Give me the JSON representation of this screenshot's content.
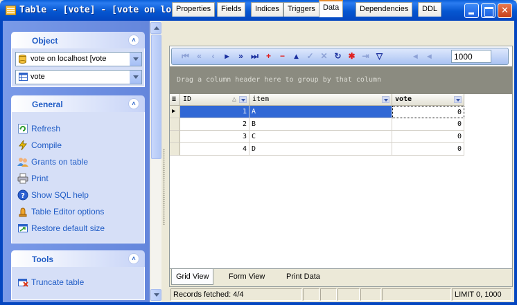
{
  "window": {
    "title": "Table - [vote] - [vote on localhost]"
  },
  "left_panel": {
    "object_group": {
      "title": "Object",
      "database_combo": "vote on localhost [vote",
      "table_combo": "vote"
    },
    "general_group": {
      "title": "General",
      "items": [
        {
          "label": "Refresh",
          "icon": "refresh-icon"
        },
        {
          "label": "Compile",
          "icon": "compile-icon"
        },
        {
          "label": "Grants on table",
          "icon": "grants-icon"
        },
        {
          "label": "Print",
          "icon": "print-icon"
        },
        {
          "label": "Show SQL help",
          "icon": "help-icon"
        },
        {
          "label": "Table Editor options",
          "icon": "options-icon"
        },
        {
          "label": "Restore default size",
          "icon": "restore-size-icon"
        }
      ]
    },
    "tools_group": {
      "title": "Tools",
      "items": [
        {
          "label": "Truncate table",
          "icon": "truncate-icon"
        }
      ]
    }
  },
  "tabs": [
    {
      "label": "Properties",
      "active": false
    },
    {
      "label": "Fields",
      "active": false
    },
    {
      "label": "Indices",
      "active": false
    },
    {
      "label": "Triggers",
      "active": false
    },
    {
      "label": "Data",
      "active": true
    },
    {
      "label": "Dependencies",
      "active": false
    },
    {
      "label": "DDL",
      "active": false
    }
  ],
  "navigator": {
    "record_limit": "1000"
  },
  "grid": {
    "group_hint": "Drag a column header here to group by that column",
    "columns": [
      "ID",
      "item",
      "vote"
    ],
    "rows": [
      {
        "id": "1",
        "item": "A",
        "vote": "0"
      },
      {
        "id": "2",
        "item": "B",
        "vote": "0"
      },
      {
        "id": "3",
        "item": "C",
        "vote": "0"
      },
      {
        "id": "4",
        "item": "D",
        "vote": "0"
      }
    ]
  },
  "view_tabs": [
    {
      "label": "Grid View",
      "active": true
    },
    {
      "label": "Form View",
      "active": false
    },
    {
      "label": "Print Data",
      "active": false
    }
  ],
  "status": {
    "records": "Records fetched: 4/4",
    "limit": "LIMIT 0, 1000"
  },
  "colors": {
    "title_bar": "#0556d0",
    "selection": "#3168d5",
    "active_tab_accent": "#e68b2c",
    "link": "#215dc6"
  }
}
